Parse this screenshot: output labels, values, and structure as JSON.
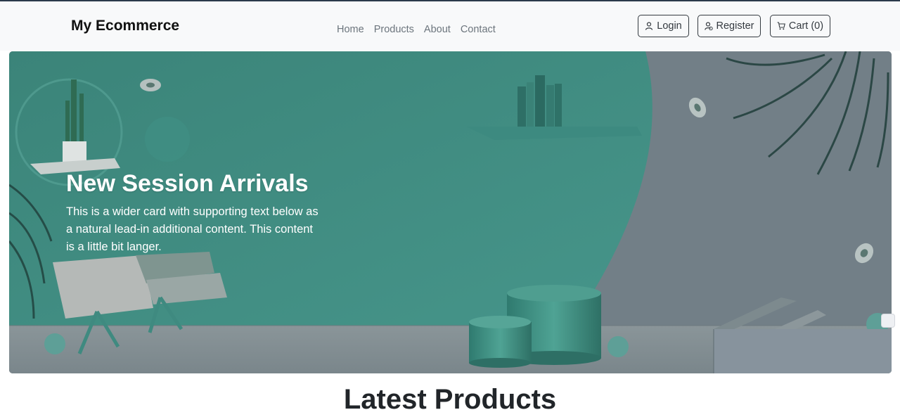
{
  "header": {
    "brand": "My Ecommerce",
    "nav": [
      {
        "label": "Home"
      },
      {
        "label": "Products"
      },
      {
        "label": "About"
      },
      {
        "label": "Contact"
      }
    ],
    "buttons": {
      "login": {
        "label": "Login",
        "icon": "person-icon"
      },
      "register": {
        "label": "Register",
        "icon": "person-add-icon"
      },
      "cart": {
        "label": "Cart (0)",
        "icon": "cart-icon"
      }
    }
  },
  "hero": {
    "title": "New Session Arrivals",
    "description": "This is a wider card with supporting text below as a natural lead-in additional content. This content is a little bit langer.",
    "colors": {
      "teal": "#3f8a80",
      "gray": "#6f8088",
      "floor": "#8c979c"
    }
  },
  "section": {
    "title": "Latest Products"
  }
}
